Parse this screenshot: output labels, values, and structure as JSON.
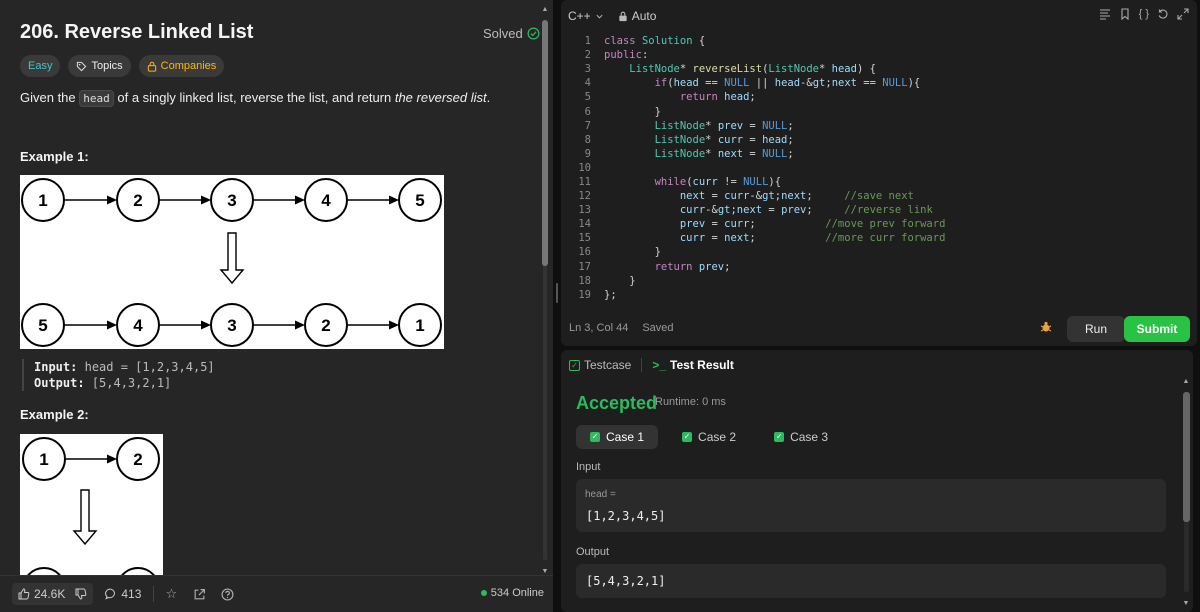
{
  "problem": {
    "title": "206. Reverse Linked List",
    "status": "Solved",
    "tags": {
      "difficulty": "Easy",
      "topics": "Topics",
      "companies": "Companies"
    },
    "description": {
      "before": "Given the ",
      "code": "head",
      "after": " of a singly linked list, reverse the list, and return ",
      "emphasis": "the reversed list",
      "end": "."
    },
    "example1": {
      "title": "Example 1:",
      "top_nodes": [
        "1",
        "2",
        "3",
        "4",
        "5"
      ],
      "bottom_nodes": [
        "5",
        "4",
        "3",
        "2",
        "1"
      ],
      "input_label": "Input:",
      "input_value": "head = [1,2,3,4,5]",
      "output_label": "Output:",
      "output_value": "[5,4,3,2,1]"
    },
    "example2": {
      "title": "Example 2:",
      "top_nodes": [
        "1",
        "2"
      ]
    }
  },
  "footer": {
    "likes": "24.6K",
    "comments": "413",
    "online": "534 Online"
  },
  "editor": {
    "language": "C++",
    "mode": "Auto",
    "lines": [
      "class Solution {",
      "public:",
      "    ListNode* reverseList(ListNode* head) {",
      "        if(head == NULL || head->next == NULL){",
      "            return head;",
      "        }",
      "        ListNode* prev = NULL;",
      "        ListNode* curr = head;",
      "        ListNode* next = NULL;",
      "",
      "        while(curr != NULL){",
      "            next = curr->next;     //save next",
      "            curr->next = prev;     //reverse link",
      "            prev = curr;           //move prev forward",
      "            curr = next;           //more curr forward",
      "        }",
      "        return prev;",
      "    }",
      "};"
    ],
    "cursor": "Ln 3, Col 44",
    "save_state": "Saved",
    "run_label": "Run",
    "submit_label": "Submit"
  },
  "result": {
    "tab_testcase": "Testcase",
    "tab_result": "Test Result",
    "verdict": "Accepted",
    "runtime": "Runtime: 0 ms",
    "cases": [
      "Case 1",
      "Case 2",
      "Case 3"
    ],
    "input_label": "Input",
    "input_key": "head =",
    "input_value": "[1,2,3,4,5]",
    "output_label": "Output",
    "output_value": "[5,4,3,2,1]"
  },
  "colors": {
    "accepted": "#2cbb5d",
    "submit": "#28c244",
    "easy": "#46c6c2",
    "companies": "#ffb800"
  }
}
